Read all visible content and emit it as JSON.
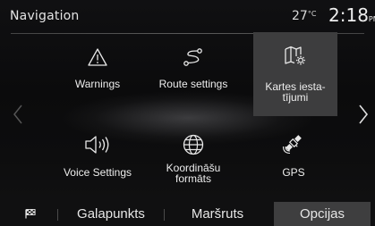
{
  "header": {
    "title": "Navigation",
    "temperature": "27",
    "temperature_unit": "°C",
    "time": "2:18",
    "time_suffix": "PM"
  },
  "menu": {
    "items": [
      {
        "label": "Warnings",
        "icon": "warning-triangle-icon"
      },
      {
        "label": "Route settings",
        "icon": "route-icon"
      },
      {
        "label_line1": "Kartes iesta-",
        "label_line2": "tījumi",
        "icon": "map-settings-icon",
        "selected": true
      },
      {
        "label": "Voice Settings",
        "icon": "speaker-icon"
      },
      {
        "label_line1": "Koordināšu",
        "label_line2": "formāts",
        "icon": "globe-icon"
      },
      {
        "label": "GPS",
        "icon": "satellite-icon"
      }
    ]
  },
  "tabs": [
    {
      "label": "",
      "icon": "checkered-flag-icon"
    },
    {
      "label": "Galapunkts"
    },
    {
      "label": "Maršruts"
    },
    {
      "label": "Opcijas",
      "active": true
    }
  ],
  "colors": {
    "background": "#0b0b0c",
    "selected": "#3d3d3e",
    "text": "#ededed"
  }
}
